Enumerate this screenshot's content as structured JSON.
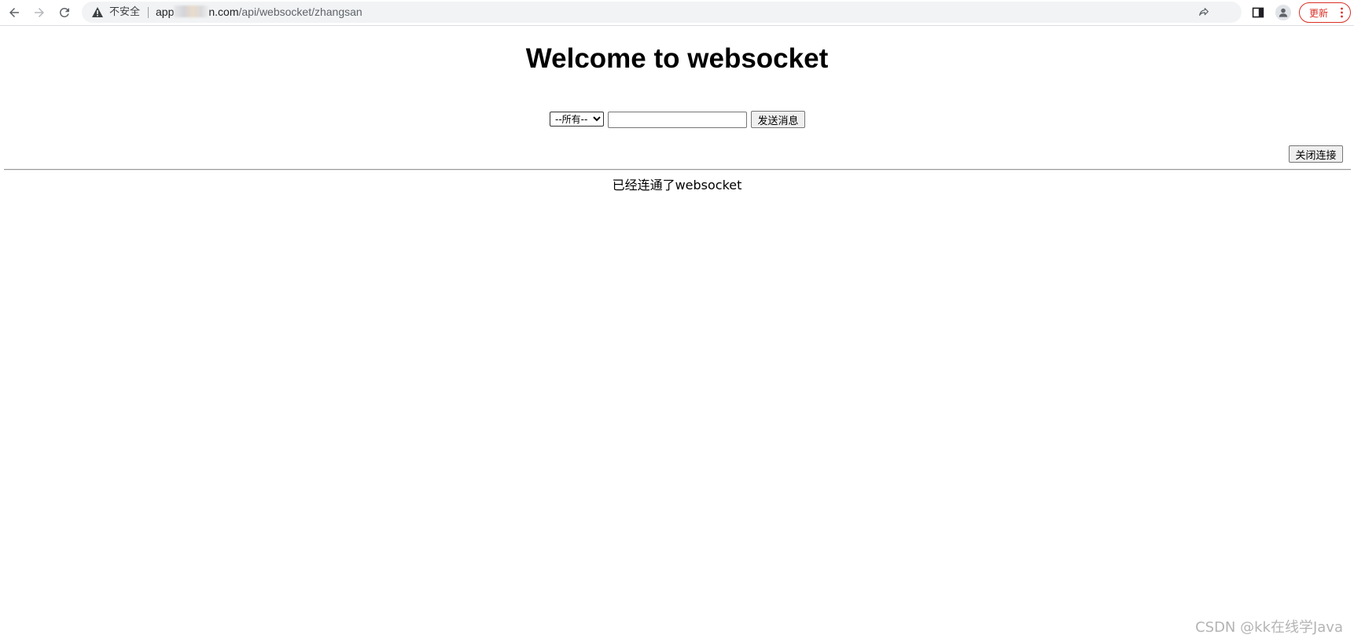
{
  "browser": {
    "security_label": "不安全",
    "url_host_prefix": "app",
    "url_host_suffix": "n.com",
    "url_path": "/api/websocket/zhangsan",
    "update_label": "更新",
    "icons": {
      "back": "arrow-left-icon",
      "forward": "arrow-right-icon",
      "reload": "reload-icon",
      "warning": "warning-triangle-icon",
      "share": "share-icon",
      "bookmark": "star-icon",
      "side_panel": "side-panel-icon",
      "profile": "profile-icon",
      "menu": "more-vert-icon"
    },
    "colors": {
      "update_accent": "#d93025",
      "omnibox_bg": "#f1f3f4"
    }
  },
  "page": {
    "title": "Welcome to websocket",
    "target_select": {
      "selected": "--所有--"
    },
    "message_input": {
      "value": ""
    },
    "send_label": "发送消息",
    "close_label": "关闭连接",
    "status_message": "已经连通了websocket"
  },
  "watermark": "CSDN @kk在线学Java"
}
